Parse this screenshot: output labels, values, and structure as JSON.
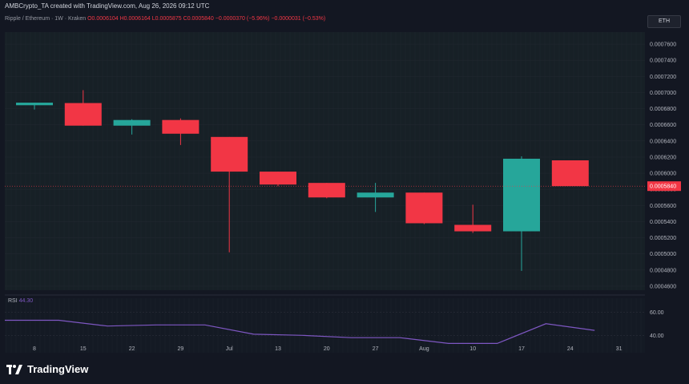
{
  "header": {
    "attribution": "AMBCrypto_TA created with TradingView.com, Aug 26, 2026 09:12 UTC"
  },
  "symbol_line": {
    "symbol": "Ripple / Ethereum · 1W · Kraken",
    "open": "O0.0006104",
    "high": "H0.0006164",
    "low": "L0.0005875",
    "close": "C0.0005840",
    "change": "−0.0000370 (−5.96%)",
    "extra": "−0.0000031 (−0.53%)"
  },
  "currency_badge": "ETH",
  "rsi": {
    "label": "RSI",
    "value": "44.30"
  },
  "footer": {
    "brand": "TradingView"
  },
  "colors": {
    "background": "#131722",
    "up": "#26a69a",
    "down": "#f23645",
    "rsi_line": "#7e57c2",
    "grid": "#1e2530"
  },
  "chart_data": [
    {
      "type": "candlestick",
      "title": "Ripple / Ethereum · 1W · Kraken",
      "x_tick_labels": [
        "8",
        "15",
        "22",
        "29",
        "Jul",
        "13",
        "20",
        "27",
        "Aug",
        "10",
        "17",
        "24",
        "31"
      ],
      "y_tick_labels": [
        "0.0007600",
        "0.0007400",
        "0.0007200",
        "0.0007000",
        "0.0006800",
        "0.0006600",
        "0.0006400",
        "0.0006200",
        "0.0006000",
        "0.0005800",
        "0.0005600",
        "0.0005400",
        "0.0005200",
        "0.0005000",
        "0.0004800",
        "0.0004600"
      ],
      "ylim": [
        0.000455,
        0.000775
      ],
      "last_price_label": "0.0005840",
      "candles": [
        {
          "x": "8",
          "open": 0.0006843,
          "high": 0.000685,
          "low": 0.000679,
          "close": 0.0006875
        },
        {
          "x": "15",
          "open": 0.000687,
          "high": 0.000703,
          "low": 0.000659,
          "close": 0.000659
        },
        {
          "x": "22",
          "open": 0.000659,
          "high": 0.000667,
          "low": 0.000648,
          "close": 0.000666
        },
        {
          "x": "29",
          "open": 0.000666,
          "high": 0.000668,
          "low": 0.000635,
          "close": 0.000649
        },
        {
          "x": "Jul",
          "open": 0.000645,
          "high": 0.000645,
          "low": 0.000502,
          "close": 0.000602
        },
        {
          "x": "13",
          "open": 0.000602,
          "high": 0.000602,
          "low": 0.000584,
          "close": 0.000586
        },
        {
          "x": "20",
          "open": 0.000588,
          "high": 0.000588,
          "low": 0.000569,
          "close": 0.00057
        },
        {
          "x": "27",
          "open": 0.00057,
          "high": 0.000588,
          "low": 0.000552,
          "close": 0.000576
        },
        {
          "x": "Aug",
          "open": 0.000576,
          "high": 0.000576,
          "low": 0.000537,
          "close": 0.000538
        },
        {
          "x": "10",
          "open": 0.000536,
          "high": 0.000561,
          "low": 0.000526,
          "close": 0.000528
        },
        {
          "x": "17",
          "open": 0.000528,
          "high": 0.000621,
          "low": 0.000479,
          "close": 0.000618
        },
        {
          "x": "24",
          "open": 0.000616,
          "high": 0.000616,
          "low": 0.000584,
          "close": 0.000584
        }
      ]
    },
    {
      "type": "line",
      "title": "RSI",
      "y_tick_labels": [
        "60.00",
        "40.00"
      ],
      "ylim": [
        25,
        72
      ],
      "values": [
        53,
        53,
        48,
        49,
        49,
        41,
        40,
        38,
        38,
        33,
        33,
        50,
        44.3
      ]
    }
  ]
}
